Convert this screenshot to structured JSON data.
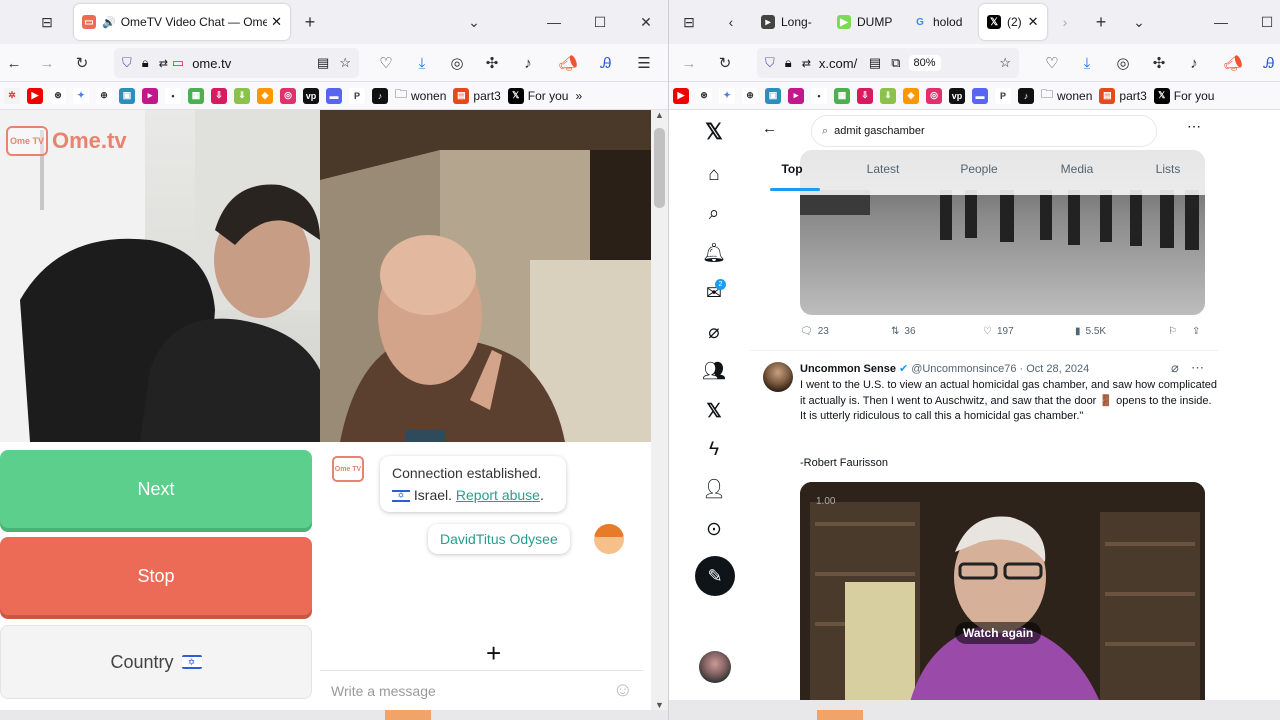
{
  "left_window": {
    "tab_title": "OmeTV Video Chat — Ome",
    "url": "ome.tv",
    "bookmarks": [
      {
        "text": "wonen"
      },
      {
        "text": "part3"
      },
      {
        "text": "For you"
      }
    ],
    "ome": {
      "logo": "Ome.tv",
      "next_label": "Next",
      "stop_label": "Stop",
      "country_label": "Country",
      "messages": {
        "connection": "Connection established.",
        "country": "Israel.",
        "report": "Report abuse",
        "report_dot": ".",
        "user_name": "DavidTitus Odysee",
        "avatar_logo": "Ome TV"
      },
      "input_placeholder": "Write a message"
    },
    "colors": {
      "next": "#5ccf8c",
      "stop": "#ec6b57",
      "link": "#2a9d8f"
    }
  },
  "right_window": {
    "tabs": [
      {
        "title": "Long-"
      },
      {
        "title": "DUMP"
      },
      {
        "title": "holod"
      },
      {
        "title": "(2)"
      }
    ],
    "url": "x.com/",
    "zoom": "80%",
    "bookmarks": [
      {
        "text": "wonen"
      },
      {
        "text": "part3"
      },
      {
        "text": "For you"
      }
    ],
    "x": {
      "search_query": "admit gaschamber",
      "tabs": [
        "Top",
        "Latest",
        "People",
        "Media",
        "Lists"
      ],
      "prev_tweet_stats": {
        "replies": "23",
        "reposts": "36",
        "likes": "197",
        "views": "5.5K"
      },
      "tweet": {
        "name": "Uncommon Sense",
        "handle": "@Uncommonsince76",
        "date": "· Oct 28, 2024",
        "text": "I went to the U.S. to view an actual homicidal gas chamber, and saw how complicated it actually is. Then I went to Auschwitz, and saw that the door 🚪 opens to the inside. It is utterly ridiculous to call this a homicidal gas chamber.\"",
        "attribution": "-Robert Faurisson",
        "video_speed": "1.00",
        "watch_again": "Watch again"
      }
    },
    "colors": {
      "accent": "#1d9bf0",
      "x_black": "#0f1419"
    }
  }
}
